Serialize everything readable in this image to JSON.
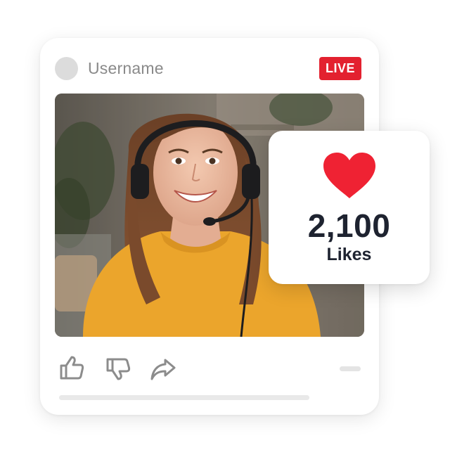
{
  "post": {
    "username": "Username",
    "live_label": "LIVE",
    "video": {
      "subject": "smiling woman wearing a headset and yellow t-shirt"
    },
    "actions": {
      "like_icon": "thumbs-up-icon",
      "dislike_icon": "thumbs-down-icon",
      "share_icon": "share-arrow-icon"
    }
  },
  "likes_card": {
    "icon": "heart-icon",
    "count": "2,100",
    "label": "Likes"
  },
  "colors": {
    "live_red": "#e3212f",
    "heart_red": "#ef2233",
    "text_dark": "#1e2330",
    "text_muted": "#8a8a8a",
    "shirt_yellow": "#eba52c"
  }
}
